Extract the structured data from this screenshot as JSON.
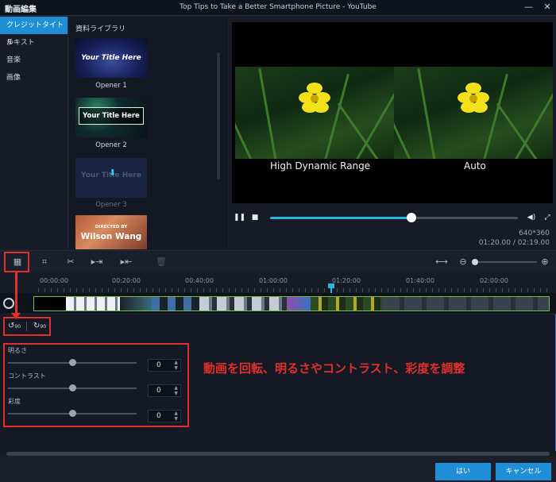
{
  "window": {
    "app_name": "動画編集",
    "title": "Top Tips to Take a Better Smartphone Picture - YouTube",
    "minimize": "—",
    "close": "✕"
  },
  "categories": [
    {
      "label": "クレジットタイトル",
      "active": true
    },
    {
      "label": "テキスト"
    },
    {
      "label": "音楽"
    },
    {
      "label": "画像"
    }
  ],
  "library": {
    "header": "資料ライブラリ",
    "items": [
      {
        "thumb_text": "Your Title Here",
        "label": "Opener 1"
      },
      {
        "thumb_text": "Your Title Here",
        "label": "Opener 2"
      },
      {
        "thumb_text": "Your Title Here",
        "label": "Opener 3"
      },
      {
        "thumb_small": "DIRECTED BY",
        "thumb_text": "Wilson Wang"
      }
    ]
  },
  "preview": {
    "caption_left": "High Dynamic Range",
    "caption_right": "Auto",
    "progress": 0.57,
    "resolution": "640*360",
    "time": "01:20.00 / 02:19.00"
  },
  "timeline": {
    "labels": [
      "00:00:00",
      "00:20:00",
      "00:40:00",
      "01:00:00",
      "01:20:00",
      "01:40:00",
      "02:00:00"
    ]
  },
  "adjust": {
    "rotate_left": "90",
    "rotate_right": "90",
    "brightness": {
      "label": "明るさ",
      "value": "0"
    },
    "contrast": {
      "label": "コントラスト",
      "value": "0"
    },
    "saturation": {
      "label": "彩度",
      "value": "0"
    }
  },
  "annotation": "動画を回転、明るさやコントラスト、彩度を調整",
  "footer": {
    "ok": "はい",
    "cancel": "キャンセル"
  },
  "colors": {
    "accent": "#1e8fd6",
    "highlight": "#e0302a",
    "progress": "#27b6e0",
    "clip_border": "#6cc04a"
  }
}
